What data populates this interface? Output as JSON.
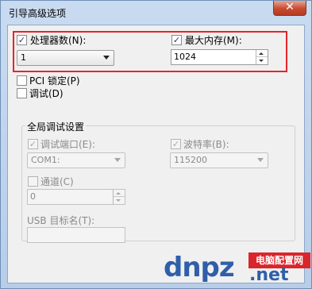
{
  "window": {
    "title": "引导高级选项",
    "close_glyph": "✕"
  },
  "processors": {
    "label": "处理器数(N):",
    "checked": true,
    "value": "1"
  },
  "max_memory": {
    "label": "最大内存(M):",
    "checked": true,
    "value": "1024"
  },
  "pci_lock": {
    "label": "PCI 锁定(P)",
    "checked": false
  },
  "debug": {
    "label": "调试(D)",
    "checked": false
  },
  "global_debug": {
    "title": "全局调试设置",
    "debug_port": {
      "label": "调试端口(E):",
      "checked": true,
      "value": "COM1:"
    },
    "baud_rate": {
      "label": "波特率(B):",
      "checked": true,
      "value": "115200"
    },
    "channel": {
      "label": "通道(C)",
      "checked": false,
      "value": "0"
    },
    "usb_target": {
      "label": "USB 目标名(T):",
      "value": ""
    }
  },
  "watermark": {
    "logo_text": "dnpz",
    "badge": "电脑配置网",
    "domain": ".net"
  },
  "colors": {
    "highlight": "#e6252a",
    "window_frame": "#b7cde8",
    "client_bg": "#f0f0f0"
  }
}
